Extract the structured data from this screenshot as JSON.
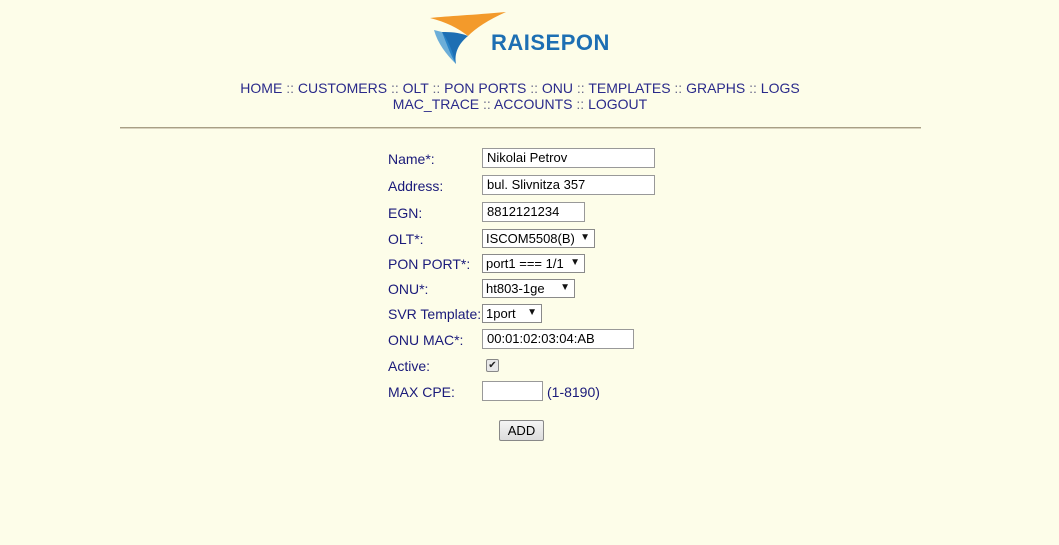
{
  "brand": {
    "name": "RAISEPON",
    "colors": {
      "text": "#1d6fb3",
      "orange": "#f39a2b",
      "blue": "#1d6fb3"
    }
  },
  "nav": {
    "row1": [
      {
        "label": "HOME"
      },
      {
        "label": "CUSTOMERS"
      },
      {
        "label": "OLT"
      },
      {
        "label": "PON PORTS"
      },
      {
        "label": "ONU"
      },
      {
        "label": "TEMPLATES"
      },
      {
        "label": "GRAPHS"
      },
      {
        "label": "LOGS"
      }
    ],
    "row2": [
      {
        "label": "MAC_TRACE"
      },
      {
        "label": "ACCOUNTS"
      },
      {
        "label": "LOGOUT"
      }
    ],
    "separator": "::"
  },
  "form": {
    "name": {
      "label": "Name*:",
      "value": "Nikolai Petrov"
    },
    "address": {
      "label": "Address:",
      "value": "bul. Slivnitza 357"
    },
    "egn": {
      "label": "EGN:",
      "value": "8812121234"
    },
    "olt": {
      "label": "OLT*:",
      "selected": "ISCOM5508(B)"
    },
    "pon_port": {
      "label": "PON PORT*:",
      "selected": "port1 === 1/1"
    },
    "onu": {
      "label": "ONU*:",
      "selected": "ht803-1ge"
    },
    "svr_template": {
      "label": "SVR Template:",
      "selected": "1port"
    },
    "onu_mac": {
      "label": "ONU MAC*:",
      "value": "00:01:02:03:04:AB"
    },
    "active": {
      "label": "Active:",
      "checked": true,
      "mark": "✔"
    },
    "max_cpe": {
      "label": "MAX CPE:",
      "value": "",
      "hint": "(1-8190)"
    },
    "submit_label": "ADD"
  }
}
